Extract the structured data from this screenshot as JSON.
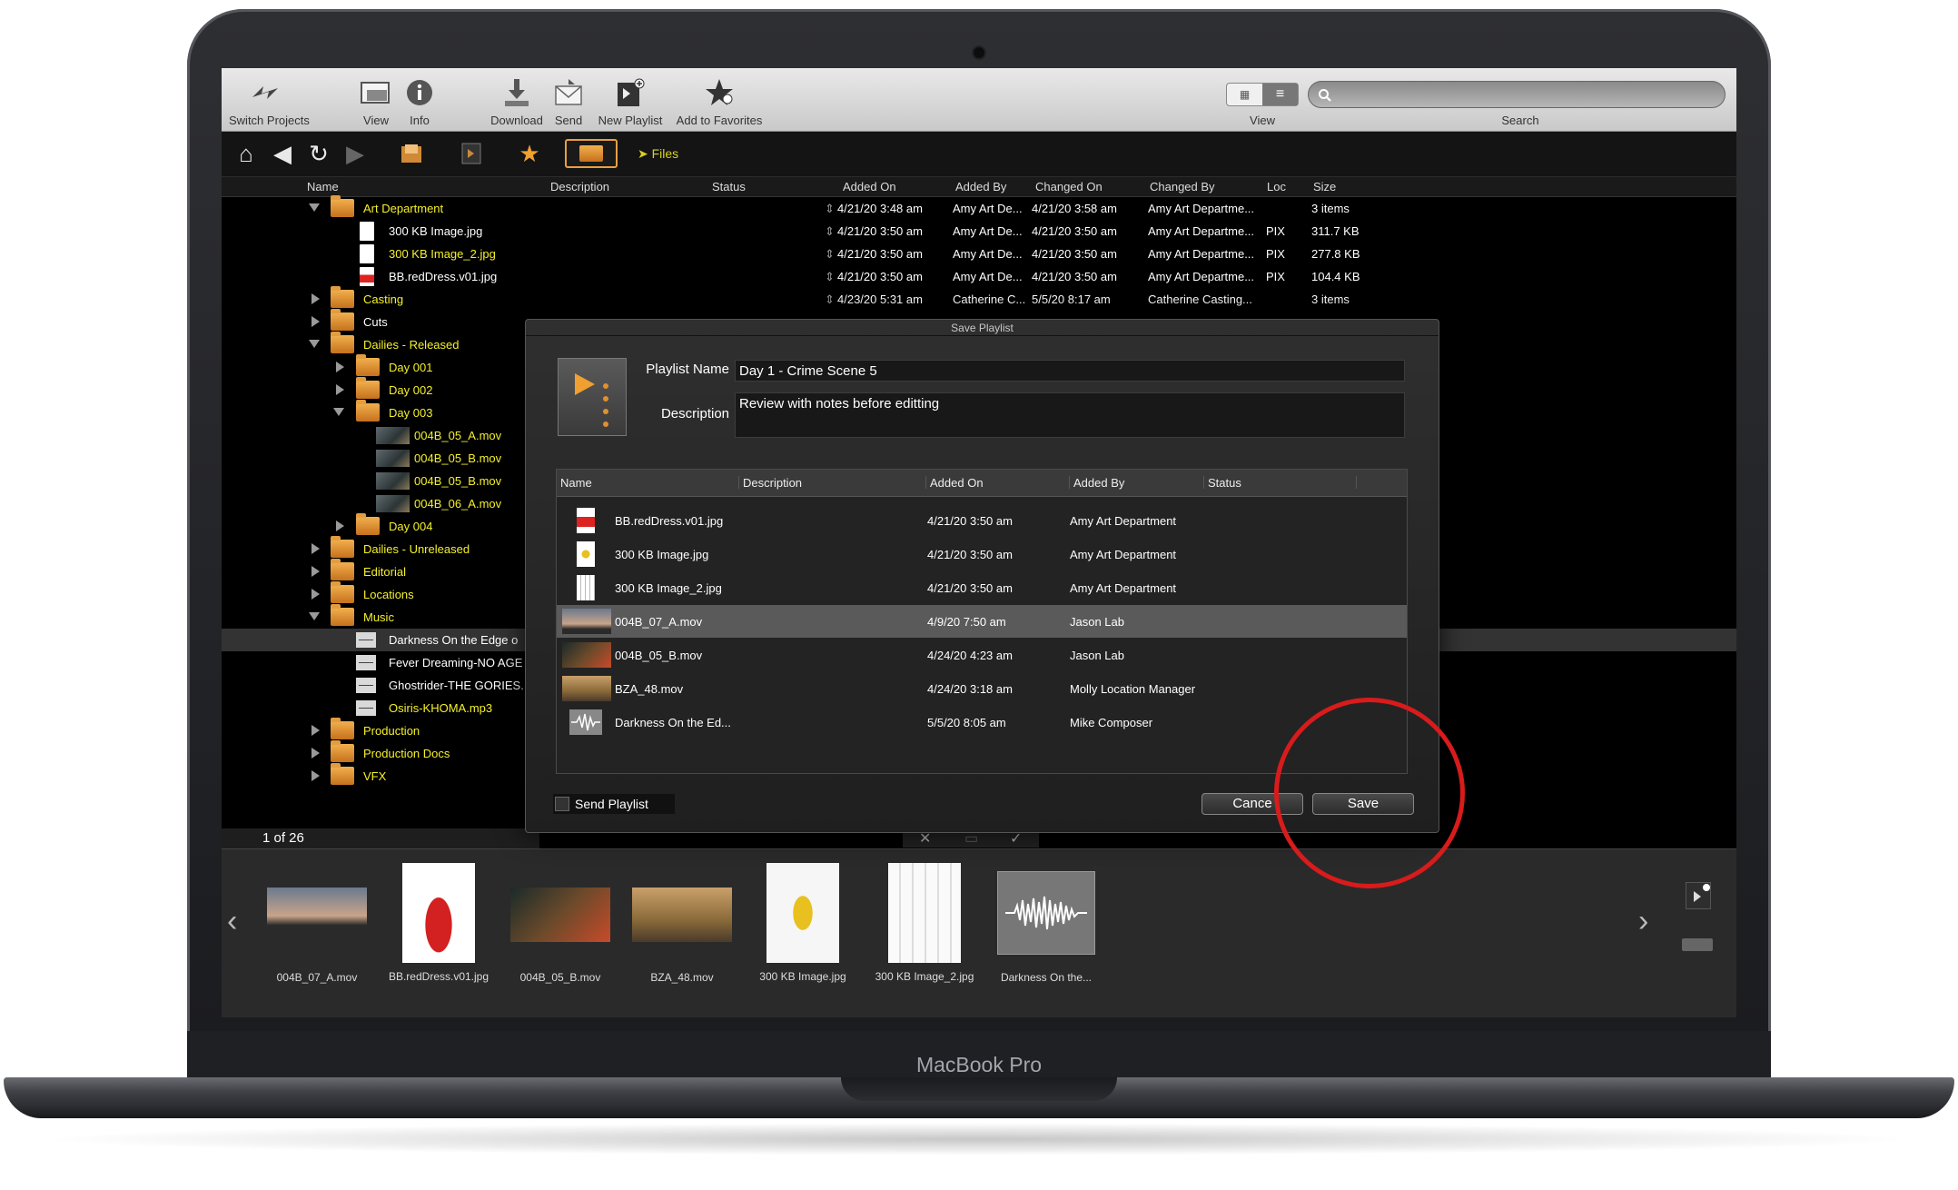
{
  "toolbar": {
    "switch_projects": "Switch Projects",
    "view": "View",
    "info": "Info",
    "download": "Download",
    "send": "Send",
    "new_playlist": "New Playlist",
    "add_to_favorites": "Add to Favorites",
    "view_right": "View",
    "search_label": "Search",
    "search_value": ""
  },
  "nav": {
    "breadcrumb": "Files"
  },
  "columns": {
    "name": "Name",
    "description": "Description",
    "status": "Status",
    "added_on": "Added On",
    "added_by": "Added By",
    "changed_on": "Changed On",
    "changed_by": "Changed By",
    "loc": "Loc",
    "size": "Size"
  },
  "tree": [
    {
      "name": "Art Department",
      "added_on": "4/21/20 3:48 am",
      "added_by": "Amy Art De...",
      "changed_on": "4/21/20 3:58 am",
      "changed_by": "Amy Art Departme...",
      "loc": "",
      "size": "3 items"
    },
    {
      "name": "300 KB Image.jpg",
      "added_on": "4/21/20 3:50 am",
      "added_by": "Amy Art De...",
      "changed_on": "4/21/20 3:50 am",
      "changed_by": "Amy Art Departme...",
      "loc": "PIX",
      "size": "311.7 KB"
    },
    {
      "name": "300 KB Image_2.jpg",
      "added_on": "4/21/20 3:50 am",
      "added_by": "Amy Art De...",
      "changed_on": "4/21/20 3:50 am",
      "changed_by": "Amy Art Departme...",
      "loc": "PIX",
      "size": "277.8 KB"
    },
    {
      "name": "BB.redDress.v01.jpg",
      "added_on": "4/21/20 3:50 am",
      "added_by": "Amy Art De...",
      "changed_on": "4/21/20 3:50 am",
      "changed_by": "Amy Art Departme...",
      "loc": "PIX",
      "size": "104.4 KB"
    },
    {
      "name": "Casting",
      "added_on": "4/23/20 5:31 am",
      "added_by": "Catherine C...",
      "changed_on": "5/5/20 8:17 am",
      "changed_by": "Catherine Casting...",
      "loc": "",
      "size": "3 items"
    },
    {
      "name": "Cuts"
    },
    {
      "name": "Dailies - Released"
    },
    {
      "name": "Day 001"
    },
    {
      "name": "Day 002"
    },
    {
      "name": "Day 003"
    },
    {
      "name": "004B_05_A.mov"
    },
    {
      "name": "004B_05_B.mov"
    },
    {
      "name": "004B_05_B.mov"
    },
    {
      "name": "004B_06_A.mov"
    },
    {
      "name": "Day 004"
    },
    {
      "name": "Dailies - Unreleased"
    },
    {
      "name": "Editorial"
    },
    {
      "name": "Locations"
    },
    {
      "name": "Music"
    },
    {
      "name": "Darkness On the Edge o"
    },
    {
      "name": "Fever Dreaming-NO AGE"
    },
    {
      "name": "Ghostrider-THE GORIES."
    },
    {
      "name": "Osiris-KHOMA.mp3"
    },
    {
      "name": "Production"
    },
    {
      "name": "Production Docs"
    },
    {
      "name": "VFX"
    }
  ],
  "status": {
    "page": "1 of 26"
  },
  "strip": [
    {
      "caption": "004B_07_A.mov"
    },
    {
      "caption": "BB.redDress.v01.jpg"
    },
    {
      "caption": "004B_05_B.mov"
    },
    {
      "caption": "BZA_48.mov"
    },
    {
      "caption": "300 KB Image.jpg"
    },
    {
      "caption": "300 KB Image_2.jpg"
    },
    {
      "caption": "Darkness On the..."
    }
  ],
  "dialog": {
    "title": "Save Playlist",
    "name_label": "Playlist Name",
    "name_value": "Day 1 - Crime Scene 5",
    "desc_label": "Description",
    "desc_value": "Review with notes before editting",
    "columns": {
      "name": "Name",
      "description": "Description",
      "added_on": "Added On",
      "added_by": "Added By",
      "status": "Status"
    },
    "rows": [
      {
        "name": "BB.redDress.v01.jpg",
        "added_on": "4/21/20 3:50 am",
        "added_by": "Amy Art Department"
      },
      {
        "name": "300 KB Image.jpg",
        "added_on": "4/21/20 3:50 am",
        "added_by": "Amy Art Department"
      },
      {
        "name": "300 KB Image_2.jpg",
        "added_on": "4/21/20 3:50 am",
        "added_by": "Amy Art Department"
      },
      {
        "name": "004B_07_A.mov",
        "added_on": "4/9/20 7:50 am",
        "added_by": "Jason Lab"
      },
      {
        "name": "004B_05_B.mov",
        "added_on": "4/24/20 4:23 am",
        "added_by": "Jason Lab"
      },
      {
        "name": "BZA_48.mov",
        "added_on": "4/24/20 3:18 am",
        "added_by": "Molly Location Manager"
      },
      {
        "name": "Darkness On the Ed...",
        "added_on": "5/5/20 8:05 am",
        "added_by": "Mike Composer"
      }
    ],
    "send_playlist": "Send Playlist",
    "cancel": "Cance",
    "save": "Save"
  },
  "device": {
    "brand": "MacBook Pro"
  },
  "colors": {
    "accent_yellow": "#f4f02a",
    "folder_orange": "#e39d3e",
    "highlight_red": "#d81b1b"
  }
}
